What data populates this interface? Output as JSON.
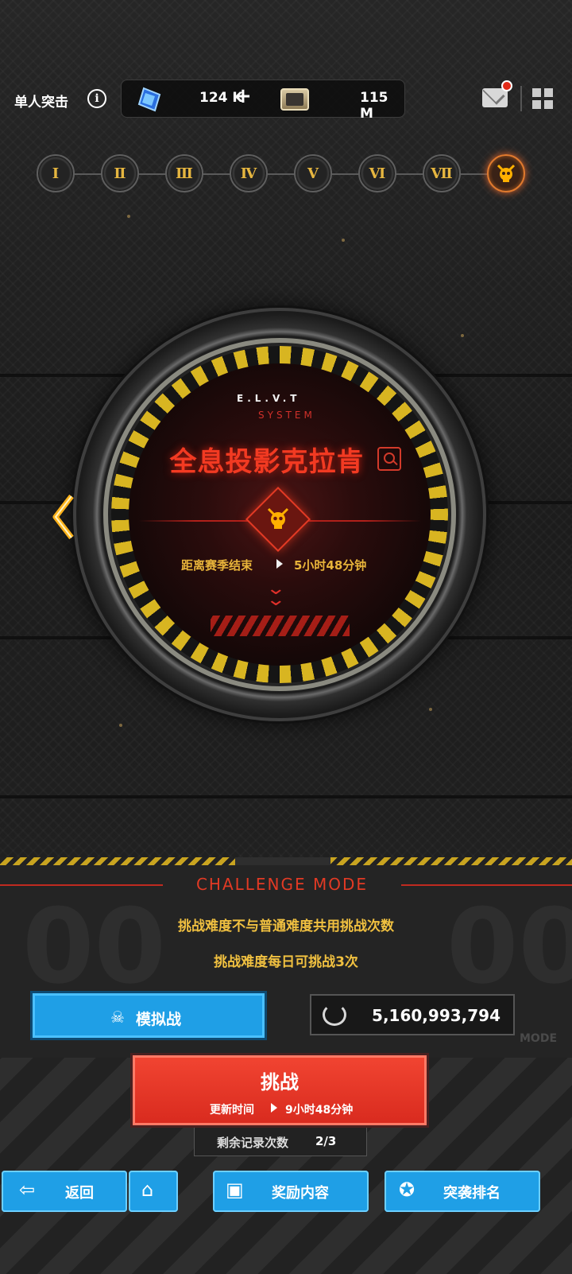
{
  "header": {
    "mode_title": "单人突击",
    "info_glyph": "i",
    "currencies": [
      {
        "icon": "crystal-icon",
        "value": "124 K"
      },
      {
        "icon": "ticket-icon",
        "value": "115 M"
      }
    ],
    "plus_glyph": "+"
  },
  "stages": {
    "labels": [
      "Ⅰ",
      "Ⅱ",
      "Ⅲ",
      "Ⅳ",
      "Ⅴ",
      "Ⅵ",
      "Ⅶ"
    ],
    "active_index": 7
  },
  "dial": {
    "system_line1": "E.L.V.T",
    "system_line2": "SYSTEM",
    "boss_name": "全息投影克拉肯",
    "season_label": "距离赛季结束",
    "season_time": "5小时48分钟"
  },
  "challenge": {
    "title": "CHALLENGE MODE",
    "rule_1": "挑战难度不与普通难度共用挑战次数",
    "rule_2": "挑战难度每日可挑战3次",
    "simulate_label": "模拟战",
    "score": "5,160,993,794",
    "mode_tag": "MODE",
    "challenge_button": "挑战",
    "refresh_label": "更新时间",
    "refresh_time": "9小时48分钟",
    "remaining_label": "剩余记录次数",
    "remaining_count": "2/3"
  },
  "bottom_nav": {
    "back": "返回",
    "rewards": "奖励内容",
    "ranking": "突袭排名"
  },
  "colors": {
    "accent_red": "#e23a24",
    "accent_gold": "#e8b43a",
    "button_blue": "#1f9fe6"
  }
}
